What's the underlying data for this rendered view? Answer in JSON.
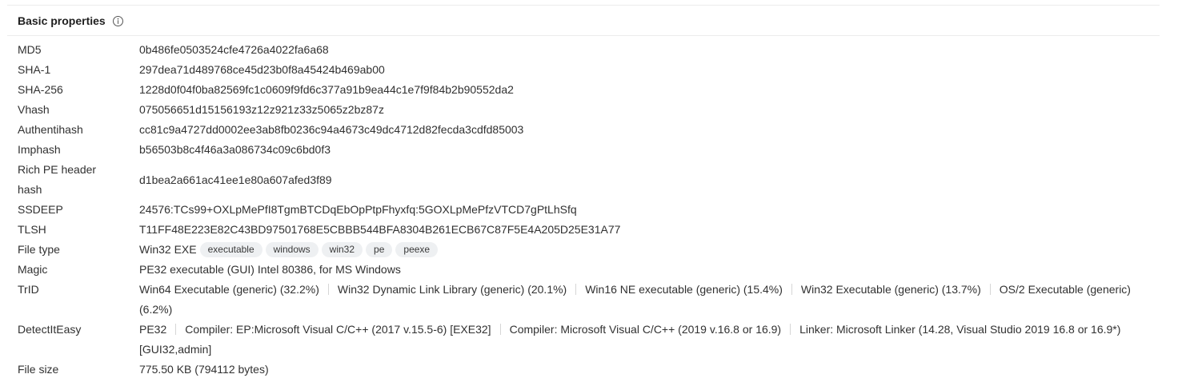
{
  "card": {
    "title": "Basic properties",
    "info_icon": "info-circle-icon"
  },
  "props": {
    "md5": {
      "label": "MD5",
      "value": "0b486fe0503524cfe4726a4022fa6a68"
    },
    "sha1": {
      "label": "SHA-1",
      "value": "297dea71d489768ce45d23b0f8a45424b469ab00"
    },
    "sha256": {
      "label": "SHA-256",
      "value": "1228d0f04f0ba82569fc1c0609f9fd6c377a91b9ea44c1e7f9f84b2b90552da2"
    },
    "vhash": {
      "label": "Vhash",
      "value": "075056651d15156193z12z921z33z5065z2bz87z"
    },
    "authentihash": {
      "label": "Authentihash",
      "value": "cc81c9a4727dd0002ee3ab8fb0236c94a4673c49dc4712d82fecda3cdfd85003"
    },
    "imphash": {
      "label": "Imphash",
      "value": "b56503b8c4f46a3a086734c09c6bd0f3"
    },
    "rich_pe": {
      "label_line1": "Rich PE header",
      "label_line2": "hash",
      "value": "d1bea2a661ac41ee1e80a607afed3f89"
    },
    "ssdeep": {
      "label": "SSDEEP",
      "value": "24576:TCs99+OXLpMePfI8TgmBTCDqEbOpPtpFhyxfq:5GOXLpMePfzVTCD7gPtLhSfq"
    },
    "tlsh": {
      "label": "TLSH",
      "value": "T11FF48E223E82C43BD97501768E5CBBB544BFA8304B261ECB67C87F5E4A205D25E31A77"
    },
    "file_type": {
      "label": "File type",
      "value": "Win32 EXE",
      "tags": [
        "executable",
        "windows",
        "win32",
        "pe",
        "peexe"
      ]
    },
    "magic": {
      "label": "Magic",
      "value": "PE32 executable (GUI) Intel 80386, for MS Windows"
    },
    "trid": {
      "label": "TrID",
      "items": [
        "Win64 Executable (generic) (32.2%)",
        "Win32 Dynamic Link Library (generic) (20.1%)",
        "Win16 NE executable (generic) (15.4%)",
        "Win32 Executable (generic) (13.7%)",
        "OS/2 Executable (generic) (6.2%)"
      ]
    },
    "die": {
      "label": "DetectItEasy",
      "items": [
        "PE32",
        "Compiler: EP:Microsoft Visual C/C++ (2017 v.15.5-6) [EXE32]",
        "Compiler: Microsoft Visual C/C++ (2019 v.16.8 or 16.9)",
        "Linker: Microsoft Linker (14.28, Visual Studio 2019 16.8 or 16.9*) [GUI32,admin]"
      ]
    },
    "file_size": {
      "label": "File size",
      "value": "775.50 KB (794112 bytes)"
    }
  }
}
